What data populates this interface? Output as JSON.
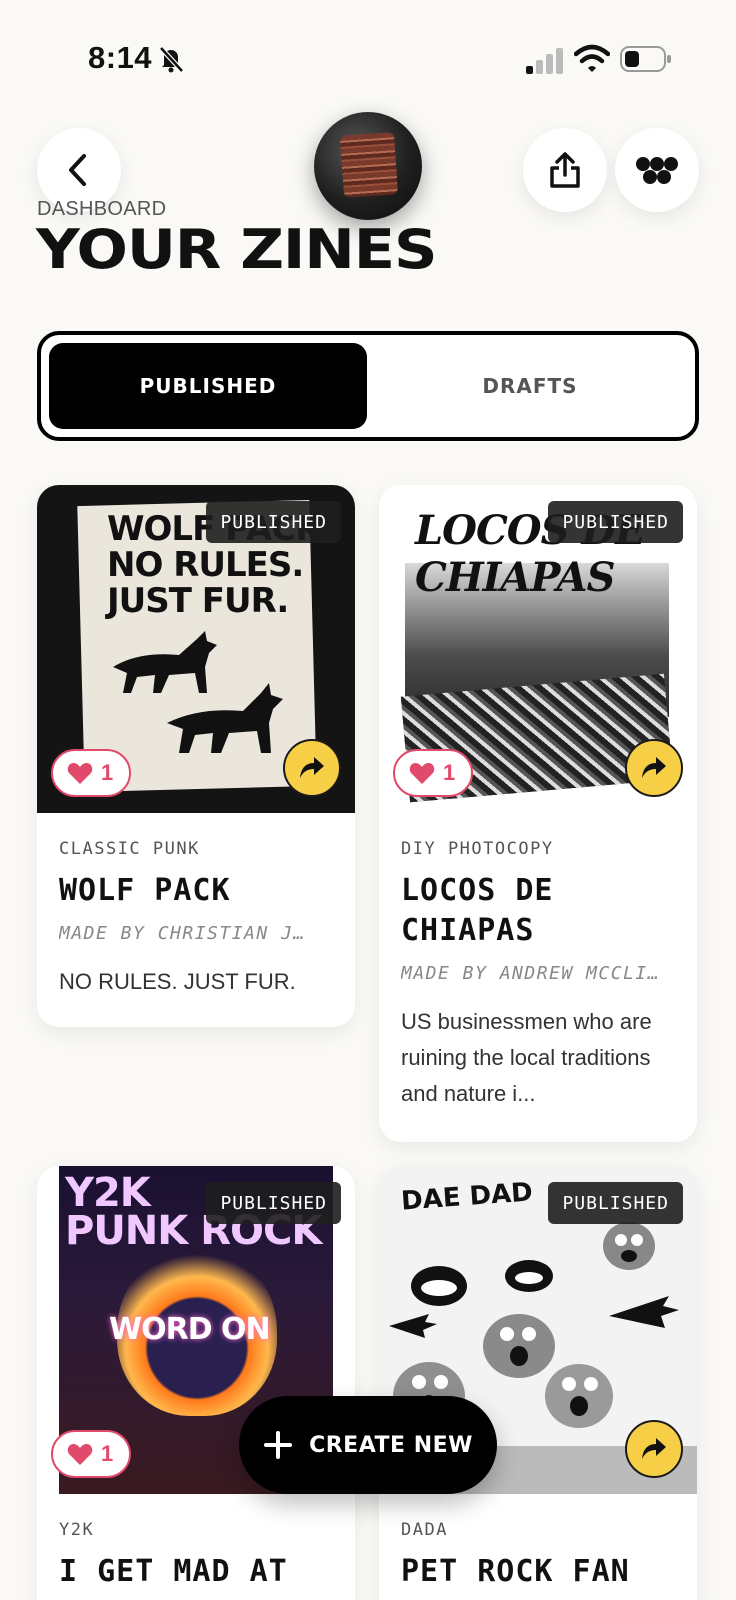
{
  "status_bar": {
    "time": "8:14"
  },
  "header": {
    "breadcrumb": "DASHBOARD",
    "title": "YOUR ZINES"
  },
  "tabs": [
    {
      "label": "PUBLISHED",
      "active": true
    },
    {
      "label": "DRAFTS",
      "active": false
    }
  ],
  "zines": [
    {
      "badge": "PUBLISHED",
      "likes": "1",
      "category": "CLASSIC PUNK",
      "title": "WOLF PACK",
      "author": "MADE BY CHRISTIAN J…",
      "description": "NO RULES. JUST FUR.",
      "cover_text": "WOLF PACK\nNO RULES.\nJUST FUR."
    },
    {
      "badge": "PUBLISHED",
      "likes": "1",
      "category": "DIY PHOTOCOPY",
      "title": "LOCOS DE CHIAPAS",
      "author": "MADE BY ANDREW MCCLI…",
      "description": "US businessmen who are ruining the local traditions and nature i...",
      "cover_text": "LOCOS DE CHIAPAS"
    },
    {
      "badge": "PUBLISHED",
      "likes": "1",
      "category": "Y2K",
      "title": "I GET MAD AT",
      "cover_text": "Y2K PUNK ROCK",
      "cover_word": "WORD ON"
    },
    {
      "badge": "PUBLISHED",
      "category": "DADA",
      "title": "PET ROCK FAN",
      "cover_text": "DAE DAD"
    }
  ],
  "create_button": {
    "label": "CREATE NEW"
  },
  "colors": {
    "accent_yellow": "#f7cf46",
    "like_pink": "#e14a6b",
    "ink": "#000000"
  }
}
